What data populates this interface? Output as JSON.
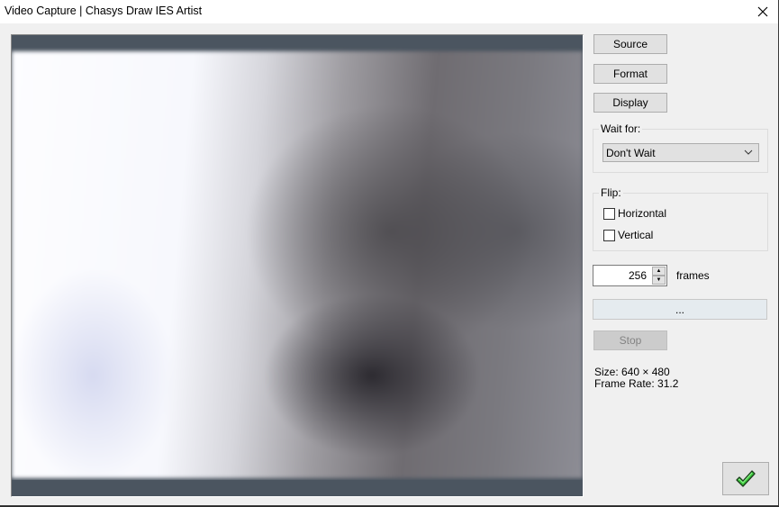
{
  "window": {
    "title": "Video Capture | Chasys Draw IES Artist",
    "close_icon": "close-icon"
  },
  "buttons": {
    "source": "Source",
    "format": "Format",
    "display": "Display",
    "stop": "Stop",
    "browse": "...",
    "ok_icon": "green-checkmark-icon"
  },
  "wait_for": {
    "label": "Wait for:",
    "selected": "Don't Wait"
  },
  "flip": {
    "label": "Flip:",
    "options": [
      {
        "label": "Horizontal",
        "checked": false
      },
      {
        "label": "Vertical",
        "checked": false
      }
    ]
  },
  "frames": {
    "value": "256",
    "unit_label": "frames"
  },
  "info": {
    "size": "Size: 640 × 480",
    "frame_rate": "Frame Rate: 31.2"
  },
  "colors": {
    "preview_bar": "#4b5560",
    "ok_green": "#3cc83c"
  }
}
